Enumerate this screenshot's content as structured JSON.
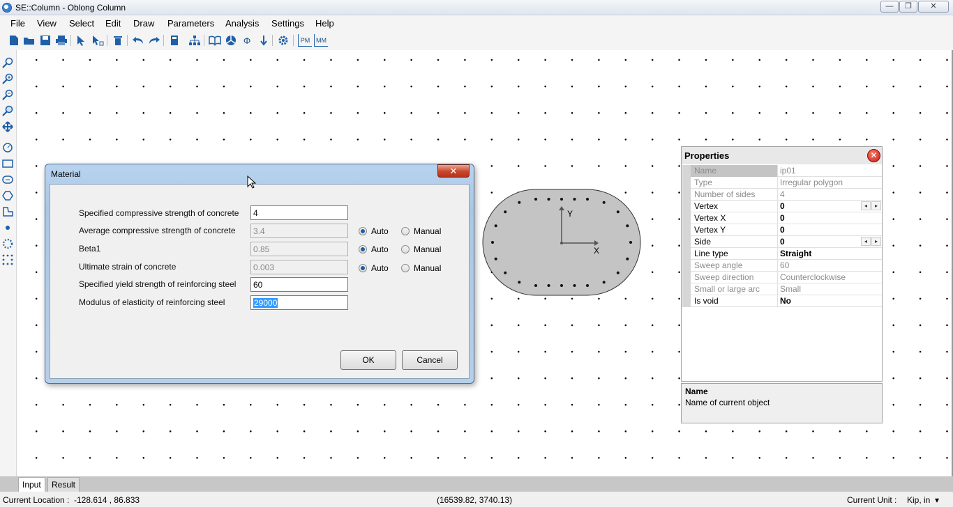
{
  "window": {
    "title": "SE::Column - Oblong Column",
    "minimize": "—",
    "restore": "❐",
    "close": "✕"
  },
  "menu": [
    "File",
    "View",
    "Select",
    "Edit",
    "Draw",
    "Parameters",
    "Analysis",
    "Settings",
    "Help"
  ],
  "toolbar_icons": [
    "new-icon",
    "open-icon",
    "save-icon",
    "print-icon",
    "select-icon",
    "select-node-icon",
    "delete-icon",
    "undo-icon",
    "redo-icon",
    "calculator-icon",
    "hierarchy-icon",
    "book-icon",
    "pie-icon",
    "phi-icon",
    "arrow-down-icon",
    "settings-icon",
    "pm-icon",
    "mm-icon"
  ],
  "toolbar_text": {
    "pm": "PM",
    "mm": "MM",
    "phi": "Φ"
  },
  "side_icons": [
    "zoom-icon",
    "zoom-in-icon",
    "zoom-out-icon",
    "zoom-window-icon",
    "pan-icon",
    "circle-tool-icon",
    "rectangle-tool-icon",
    "oval-tool-icon",
    "polygon-tool-icon",
    "irregular-polygon-tool-icon",
    "point-tool-icon",
    "circular-pattern-icon",
    "grid-pattern-icon"
  ],
  "dialog": {
    "title": "Material",
    "close": "✕",
    "rows": [
      {
        "label": "Specified compressive strength of concrete",
        "value": "4",
        "enabled": true
      },
      {
        "label": "Average compressive strength of concrete",
        "value": "3.4",
        "enabled": false,
        "mode": "Auto"
      },
      {
        "label": "Beta1",
        "value": "0.85",
        "enabled": false,
        "mode": "Auto"
      },
      {
        "label": "Ultimate strain of concrete",
        "value": "0.003",
        "enabled": false,
        "mode": "Auto"
      },
      {
        "label": "Specified yield strength of reinforcing steel",
        "value": "60",
        "enabled": true
      },
      {
        "label": "Modulus of elasticity of reinforcing steel",
        "value": "29000",
        "enabled": true
      }
    ],
    "auto_label": "Auto",
    "manual_label": "Manual",
    "ok": "OK",
    "cancel": "Cancel"
  },
  "shape": {
    "x_axis": "X",
    "y_axis": "Y"
  },
  "properties": {
    "title": "Properties",
    "close": "✕",
    "rows": [
      {
        "name": "Name",
        "value": "ip01",
        "state": "ro"
      },
      {
        "name": "Type",
        "value": "Irregular polygon",
        "state": "ro"
      },
      {
        "name": "Number of sides",
        "value": "4",
        "state": "ro"
      },
      {
        "name": "Vertex",
        "value": "0",
        "state": "ed",
        "spinner": true
      },
      {
        "name": "Vertex X",
        "value": "0",
        "state": "ed"
      },
      {
        "name": "Vertex Y",
        "value": "0",
        "state": "ed"
      },
      {
        "name": "Side",
        "value": "0",
        "state": "ed",
        "spinner": true
      },
      {
        "name": "Line type",
        "value": "Straight",
        "state": "ed"
      },
      {
        "name": "Sweep angle",
        "value": "60",
        "state": "ro"
      },
      {
        "name": "Sweep direction",
        "value": "Counterclockwise",
        "state": "ro"
      },
      {
        "name": "Small or large arc",
        "value": "Small",
        "state": "ro"
      },
      {
        "name": "Is void",
        "value": "No",
        "state": "ed"
      }
    ],
    "desc_title": "Name",
    "desc_text": "Name of current object"
  },
  "tabs": [
    "Input",
    "Result"
  ],
  "status": {
    "location_label": "Current Location :",
    "location_value": "-128.614 , 86.833",
    "coords": "(16539.82, 3740.13)",
    "unit_label": "Current Unit :",
    "unit_value": "Kip, in",
    "unit_arrow": "▾"
  },
  "colors": {
    "dialog_frame": "#a9c8e8",
    "shape_fill": "#c4c4c4",
    "selection": "#3399ff"
  }
}
